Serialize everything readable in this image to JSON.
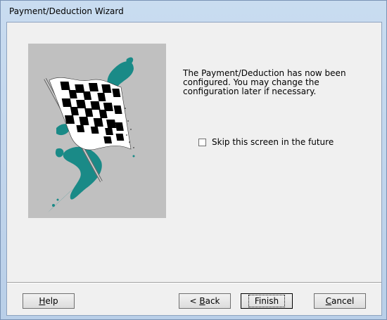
{
  "window": {
    "title": "Payment/Deduction Wizard"
  },
  "message": "The Payment/Deduction has now been\nconfigured.  You may change the\nconfiguration later if necessary.",
  "skip": {
    "label": "Skip this screen in the future",
    "checked": false
  },
  "buttons": {
    "help": {
      "pre": "",
      "accel": "H",
      "post": "elp"
    },
    "back": {
      "pre": "< ",
      "accel": "B",
      "post": "ack"
    },
    "finish": {
      "label": "Finish"
    },
    "cancel": {
      "pre": "",
      "accel": "C",
      "post": "ancel"
    }
  },
  "colors": {
    "art_background": "#c0c0c0",
    "splash": "#1a8a87"
  },
  "icons": {
    "art": "checkered-flag-icon"
  }
}
